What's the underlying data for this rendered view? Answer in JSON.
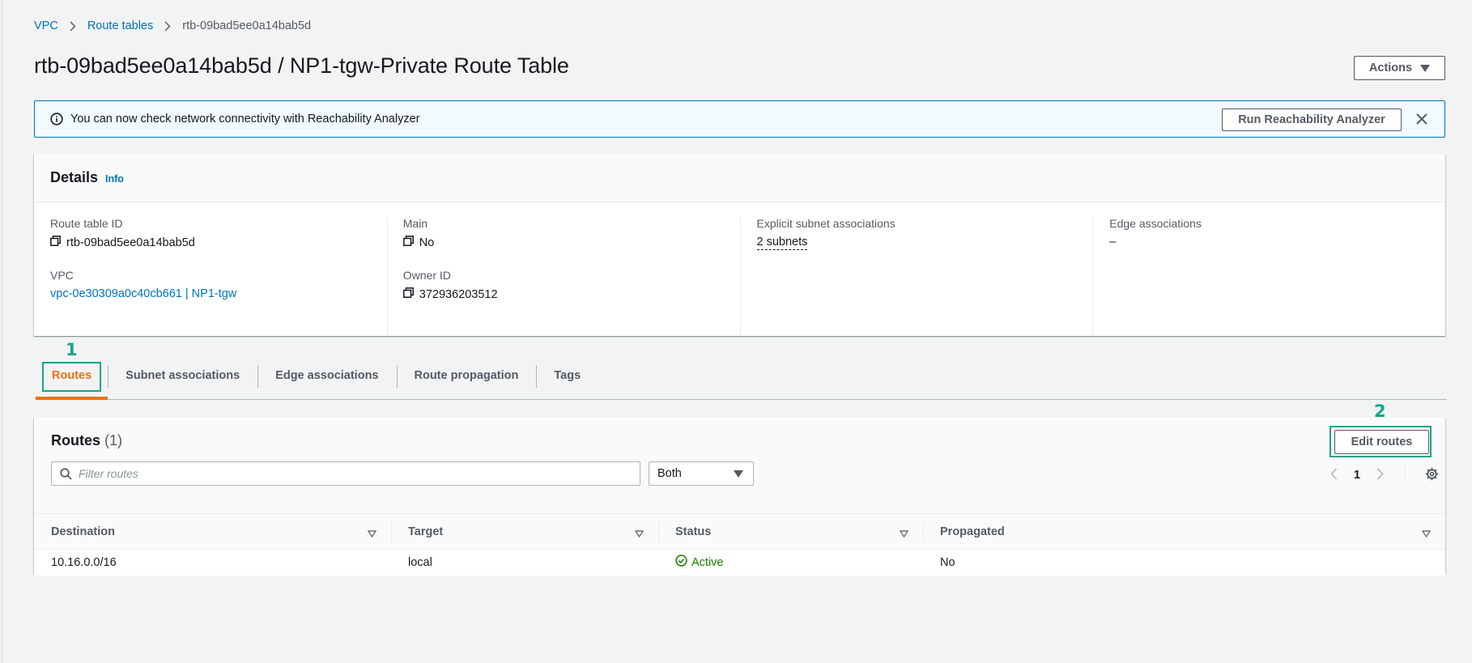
{
  "breadcrumb": {
    "items": [
      "VPC",
      "Route tables"
    ],
    "current": "rtb-09bad5ee0a14bab5d"
  },
  "header": {
    "title": "rtb-09bad5ee0a14bab5d / NP1-tgw-Private Route Table",
    "actions_label": "Actions"
  },
  "flash": {
    "message": "You can now check network connectivity with Reachability Analyzer",
    "button_label": "Run Reachability Analyzer"
  },
  "details": {
    "title": "Details",
    "info_label": "Info",
    "route_table_id_label": "Route table ID",
    "route_table_id": "rtb-09bad5ee0a14bab5d",
    "vpc_label": "VPC",
    "vpc_value": "vpc-0e30309a0c40cb661 | NP1-tgw",
    "main_label": "Main",
    "main_value": "No",
    "owner_id_label": "Owner ID",
    "owner_id": "372936203512",
    "explicit_subnet_label": "Explicit subnet associations",
    "explicit_subnet_value": "2 subnets",
    "edge_label": "Edge associations",
    "edge_value": "–"
  },
  "tabs": [
    "Routes",
    "Subnet associations",
    "Edge associations",
    "Route propagation",
    "Tags"
  ],
  "annotations": {
    "one": "1",
    "two": "2",
    "color": "#17a589"
  },
  "routes": {
    "title": "Routes",
    "count": "(1)",
    "edit_label": "Edit routes",
    "filter_placeholder": "Filter routes",
    "filter_value": "",
    "select_value": "Both",
    "page": "1",
    "columns": [
      "Destination",
      "Target",
      "Status",
      "Propagated"
    ],
    "rows": [
      {
        "destination": "10.16.0.0/16",
        "target": "local",
        "status": "Active",
        "propagated": "No"
      }
    ]
  },
  "colors": {
    "accent": "#ec7211",
    "link": "#0073bb",
    "success": "#1d8102"
  }
}
